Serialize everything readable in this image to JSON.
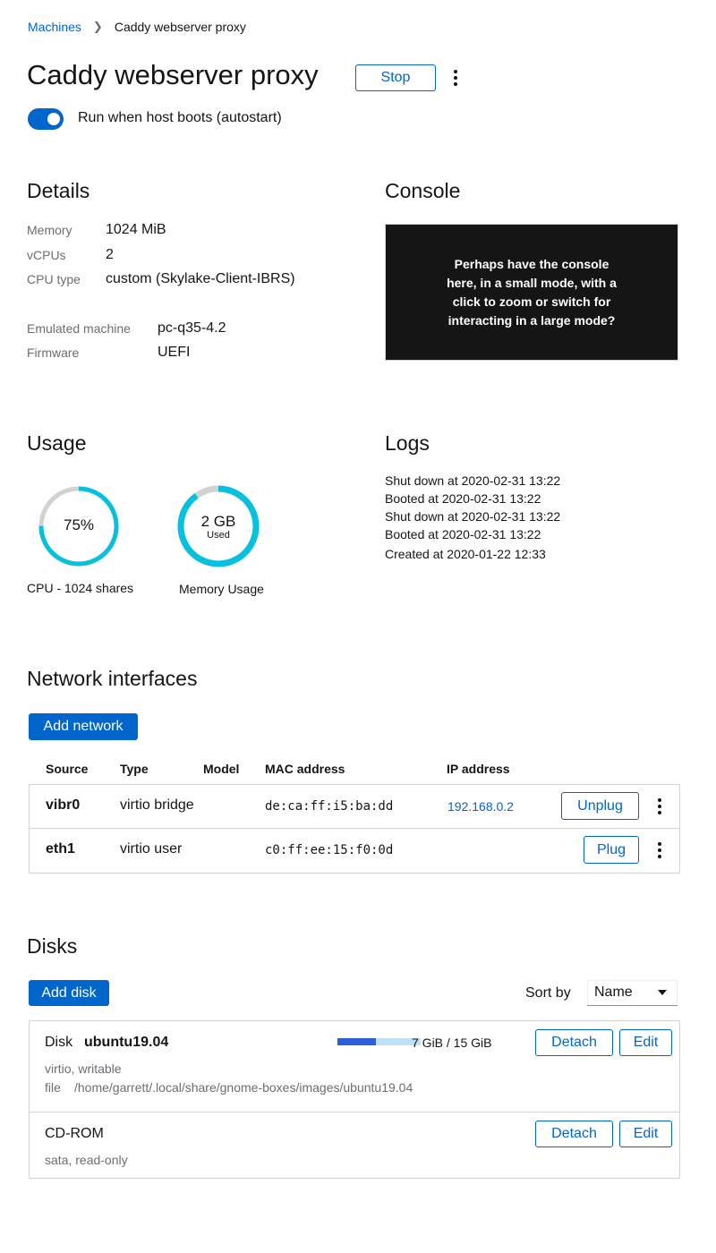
{
  "breadcrumb": {
    "parent": "Machines",
    "current": "Caddy webserver proxy"
  },
  "header": {
    "title": "Caddy webserver proxy",
    "stop_label": "Stop"
  },
  "autostart": {
    "label": "Run when host boots (autostart)",
    "enabled": true
  },
  "details": {
    "title": "Details",
    "rows": [
      {
        "label": "Memory",
        "value": "1024 MiB"
      },
      {
        "label": "vCPUs",
        "value": "2"
      },
      {
        "label": "CPU type",
        "value": "custom (Skylake-Client-IBRS)"
      }
    ],
    "rows2": [
      {
        "label": "Emulated machine",
        "value": "pc-q35-4.2"
      },
      {
        "label": "Firmware",
        "value": "UEFI"
      }
    ]
  },
  "console": {
    "title": "Console",
    "text": "Perhaps have the console here, in a small mode, with a click to zoom or switch for interacting in a large mode?"
  },
  "usage": {
    "title": "Usage",
    "cpu": {
      "value_text": "75%",
      "label": "CPU - 1024 shares",
      "fraction": 0.75
    },
    "memory": {
      "value_text": "2 GB",
      "sub": "Used",
      "label": "Memory Usage",
      "fraction": 0.9
    },
    "colors": {
      "filled": "#06c0e0",
      "empty": "#d2d2d2"
    }
  },
  "logs": {
    "title": "Logs",
    "entries": [
      "Shut down at 2020-02-31 13:22",
      "Booted at 2020-02-31 13:22",
      "Shut down at 2020-02-31 13:22",
      "Booted at 2020-02-31 13:22",
      "Created at 2020-01-22 12:33"
    ]
  },
  "network": {
    "title": "Network interfaces",
    "add_label": "Add network",
    "columns": [
      "Source",
      "Type",
      "Model",
      "MAC address",
      "IP address"
    ],
    "rows": [
      {
        "source": "vibr0",
        "type": "virtio bridge",
        "model": "",
        "mac": "de:ca:ff:i5:ba:dd",
        "ip": "192.168.0.2",
        "action": "Unplug"
      },
      {
        "source": "eth1",
        "type": "virtio user",
        "model": "",
        "mac": "c0:ff:ee:15:f0:0d",
        "ip": "",
        "action": "Plug"
      }
    ]
  },
  "disks": {
    "title": "Disks",
    "add_label": "Add disk",
    "sort_label": "Sort by",
    "sort_value": "Name",
    "items": [
      {
        "type": "Disk",
        "name": "ubuntu19.04",
        "usage_text": "7 GiB / 15 GiB",
        "usage_fraction": 0.4667,
        "meta": "virtio, writable",
        "file_label": "file",
        "file_path": "/home/garrett/.local/share/gnome-boxes/images/ubuntu19.04",
        "detach_label": "Detach",
        "edit_label": "Edit"
      },
      {
        "type": "CD-ROM",
        "meta": "sata, read-only",
        "detach_label": "Detach",
        "edit_label": "Edit"
      }
    ],
    "colors": {
      "used": "#2b5fd9",
      "free": "#bee1f4"
    }
  }
}
